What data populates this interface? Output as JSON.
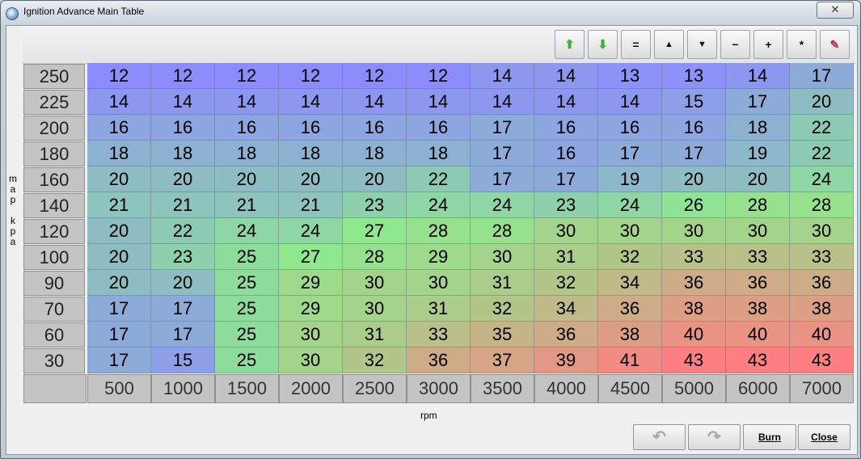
{
  "window": {
    "title": "Ignition Advance Main Table",
    "close_glyph": "✕"
  },
  "toolbar": [
    {
      "name": "increase-green-icon",
      "glyph": "⬆",
      "color": "#3fae3f"
    },
    {
      "name": "decrease-green-icon",
      "glyph": "⬇",
      "color": "#3fae3f"
    },
    {
      "name": "set-equal-button",
      "glyph": "="
    },
    {
      "name": "increment-button",
      "glyph": "▲"
    },
    {
      "name": "decrement-button",
      "glyph": "▼"
    },
    {
      "name": "subtract-button",
      "glyph": "−"
    },
    {
      "name": "add-button",
      "glyph": "+"
    },
    {
      "name": "multiply-button",
      "glyph": "*"
    },
    {
      "name": "interpolate-pen-icon",
      "glyph": "✎",
      "color": "#c0206a"
    }
  ],
  "y_axis": {
    "title": "map kpa",
    "title_letters": [
      "m",
      "a",
      "p",
      "",
      "k",
      "p",
      "a"
    ],
    "values": [
      "250",
      "225",
      "200",
      "180",
      "160",
      "140",
      "120",
      "100",
      "90",
      "70",
      "60",
      "30"
    ]
  },
  "x_axis": {
    "title": "rpm",
    "values": [
      "500",
      "1000",
      "1500",
      "2000",
      "2500",
      "3000",
      "3500",
      "4000",
      "4500",
      "5000",
      "6000",
      "7000"
    ]
  },
  "table": [
    [
      12,
      12,
      12,
      12,
      12,
      12,
      14,
      14,
      13,
      13,
      14,
      17
    ],
    [
      14,
      14,
      14,
      14,
      14,
      14,
      14,
      14,
      14,
      15,
      17,
      20
    ],
    [
      16,
      16,
      16,
      16,
      16,
      16,
      17,
      16,
      16,
      16,
      18,
      22
    ],
    [
      18,
      18,
      18,
      18,
      18,
      18,
      17,
      16,
      17,
      17,
      19,
      22
    ],
    [
      20,
      20,
      20,
      20,
      20,
      22,
      17,
      17,
      19,
      20,
      20,
      24
    ],
    [
      21,
      21,
      21,
      21,
      23,
      24,
      24,
      23,
      24,
      26,
      28,
      28
    ],
    [
      20,
      22,
      24,
      24,
      27,
      28,
      28,
      30,
      30,
      30,
      30,
      30
    ],
    [
      20,
      23,
      25,
      27,
      28,
      29,
      30,
      31,
      32,
      33,
      33,
      33
    ],
    [
      20,
      20,
      25,
      29,
      30,
      30,
      31,
      32,
      34,
      36,
      36,
      36
    ],
    [
      17,
      17,
      25,
      29,
      30,
      31,
      32,
      34,
      36,
      38,
      38,
      38
    ],
    [
      17,
      17,
      25,
      30,
      31,
      33,
      35,
      36,
      38,
      40,
      40,
      40
    ],
    [
      17,
      15,
      25,
      30,
      32,
      36,
      37,
      39,
      41,
      43,
      43,
      43
    ]
  ],
  "color_scale": {
    "low": "#8c8cff",
    "mid": "#8ee88e",
    "high": "#ff7e82"
  },
  "buttons": {
    "undo": "↶",
    "redo": "↷",
    "burn": "Burn",
    "close": "Close"
  }
}
